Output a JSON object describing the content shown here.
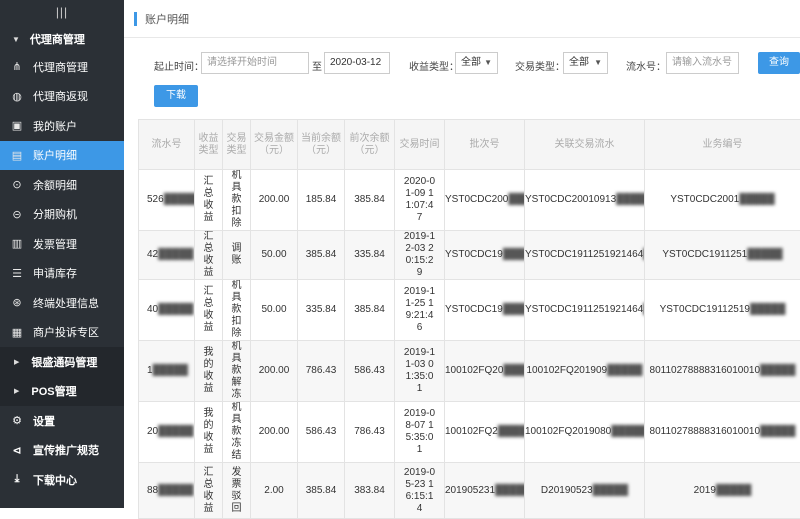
{
  "sidebar": {
    "menu_symbol": "|||",
    "group_title": "代理商管理",
    "items": [
      {
        "label": "代理商管理",
        "icon": "sitemap-icon"
      },
      {
        "label": "代理商返现",
        "icon": "money-bag-icon"
      },
      {
        "label": "我的账户",
        "icon": "id-card-icon"
      },
      {
        "label": "账户明细",
        "icon": "document-icon",
        "active": true
      },
      {
        "label": "余额明细",
        "icon": "coin-icon"
      },
      {
        "label": "分期购机",
        "icon": "installment-icon"
      },
      {
        "label": "发票管理",
        "icon": "invoice-icon"
      },
      {
        "label": "申请库存",
        "icon": "list-icon"
      },
      {
        "label": "终端处理信息",
        "icon": "terminal-icon"
      },
      {
        "label": "商户投诉专区",
        "icon": "complaint-icon"
      }
    ],
    "sub_groups": [
      {
        "label": "银盛通码管理"
      },
      {
        "label": "POS管理"
      }
    ],
    "bottom_items": [
      {
        "label": "设置",
        "icon": "gear-icon"
      },
      {
        "label": "宣传推广规范",
        "icon": "share-icon"
      },
      {
        "label": "下载中心",
        "icon": "download-icon"
      }
    ]
  },
  "header": {
    "title": "账户明细"
  },
  "filters": {
    "start_label": "起止时间：",
    "start_placeholder": "请选择开始时间",
    "to_label": "至",
    "end_value": "2020-03-12",
    "income_type_label": "收益类型：",
    "income_type_value": "全部",
    "trade_type_label": "交易类型：",
    "trade_type_value": "全部",
    "serial_label": "流水号：",
    "serial_placeholder": "请输入流水号",
    "search_button": "查询",
    "download_button": "下载"
  },
  "table": {
    "columns": [
      "流水号",
      "收益类型",
      "交易类型",
      "交易金额（元）",
      "当前余额（元）",
      "前次余额（元）",
      "交易时间",
      "批次号",
      "关联交易流水",
      "业务编号"
    ],
    "rows": [
      {
        "serial": "526",
        "income_type": "汇总收益",
        "trade_type": "机具款扣除",
        "amount": "200.00",
        "balance": "185.84",
        "prev_balance": "385.84",
        "time": "2020-01-09 11:07:47",
        "batch": "YST0CDC200",
        "related": "YST0CDC20010913",
        "biz_no": "YST0CDC2001"
      },
      {
        "serial": "42",
        "income_type": "汇总收益",
        "trade_type": "调账",
        "amount": "50.00",
        "balance": "385.84",
        "prev_balance": "335.84",
        "time": "2019-12-03 20:15:29",
        "batch": "YST0CDC19",
        "related": "YST0CDC1911251921464",
        "biz_no": "YST0CDC1911251"
      },
      {
        "serial": "40",
        "income_type": "汇总收益",
        "trade_type": "机具款扣除",
        "amount": "50.00",
        "balance": "335.84",
        "prev_balance": "385.84",
        "time": "2019-11-25 19:21:46",
        "batch": "YST0CDC19",
        "related": "YST0CDC1911251921464",
        "biz_no": "YST0CDC19112519"
      },
      {
        "serial": "1",
        "income_type": "我的收益",
        "trade_type": "机具款解冻",
        "amount": "200.00",
        "balance": "786.43",
        "prev_balance": "586.43",
        "time": "2019-11-03 01:35:01",
        "batch": "100102FQ20",
        "related": "100102FQ201909",
        "biz_no": "80110278888316010010"
      },
      {
        "serial": "20",
        "income_type": "我的收益",
        "trade_type": "机具款冻结",
        "amount": "200.00",
        "balance": "586.43",
        "prev_balance": "786.43",
        "time": "2019-08-07 15:35:01",
        "batch": "100102FQ2",
        "related": "100102FQ2019080",
        "biz_no": "80110278888316010010"
      },
      {
        "serial": "88",
        "income_type": "汇总收益",
        "trade_type": "发票驳回",
        "amount": "2.00",
        "balance": "385.84",
        "prev_balance": "383.84",
        "time": "2019-05-23 16:15:14",
        "batch": "201905231",
        "related": "D20190523",
        "biz_no": "2019"
      }
    ]
  }
}
